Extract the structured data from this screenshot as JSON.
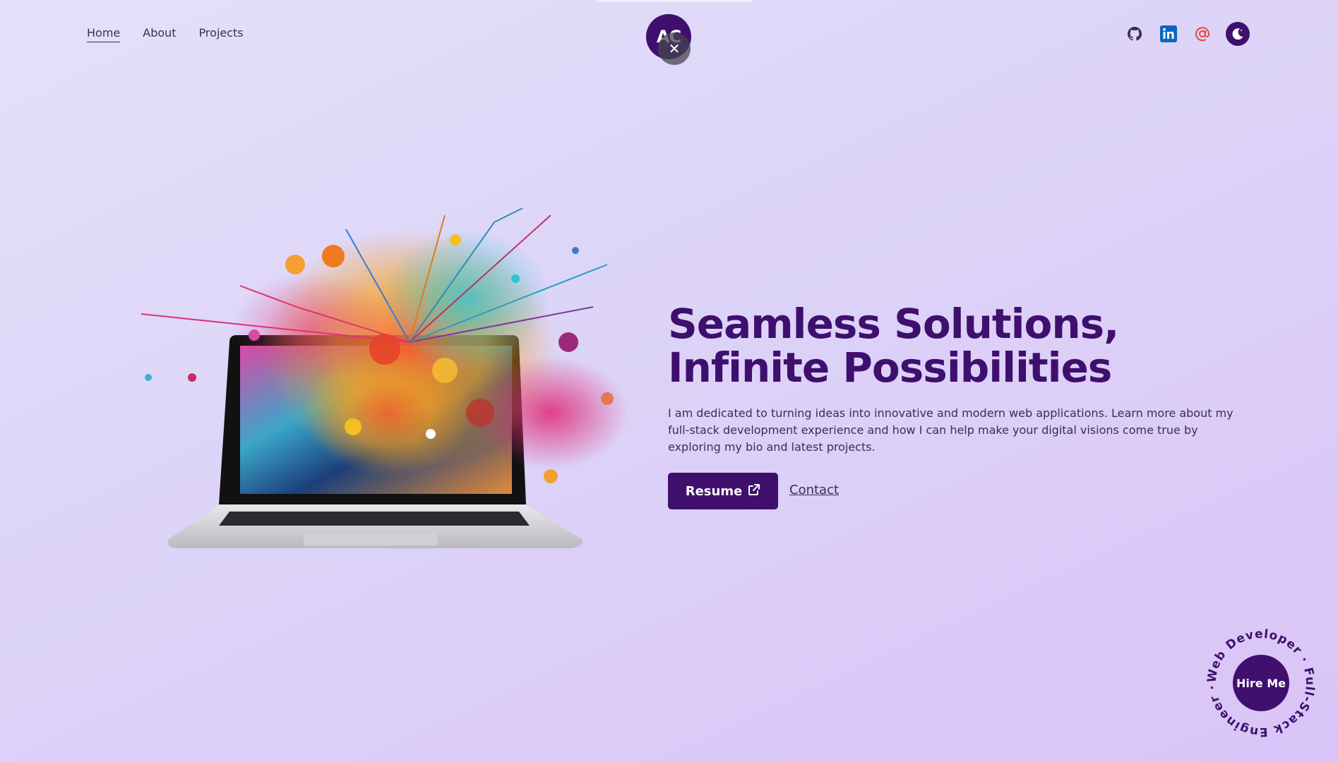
{
  "nav": {
    "links": [
      {
        "label": "Home",
        "active": true
      },
      {
        "label": "About",
        "active": false
      },
      {
        "label": "Projects",
        "active": false
      }
    ]
  },
  "logo": {
    "initials": "AC"
  },
  "social": {
    "icons": [
      "github-icon",
      "linkedin-icon",
      "email-at-icon",
      "moon-icon"
    ],
    "colors": {
      "github": "#3b2f4f",
      "linkedin": "#0a66c2",
      "email": "#e34a3b",
      "theme": "#3f0f6e"
    }
  },
  "hero": {
    "title_line1": "Seamless Solutions,",
    "title_line2": "Infinite Possibilities",
    "description": "I am dedicated to turning ideas into innovative and modern web applications. Learn more about my full-stack development experience and how I can help make your digital visions come true by exploring my bio and latest projects.",
    "resume_label": "Resume",
    "contact_label": "Contact"
  },
  "hire": {
    "button_label": "Hire Me",
    "ring_text": "Web Developer · Full-Stack Engineer · "
  },
  "colors": {
    "accent": "#3f0f6e",
    "text": "#3b2f4f"
  }
}
